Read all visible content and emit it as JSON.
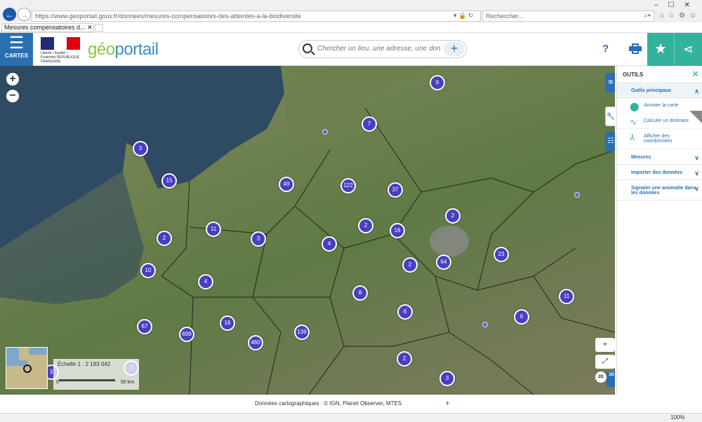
{
  "browser": {
    "url": "https://www.geoportail.gouv.fr/donnees/mesures-compensatoires-des-atteintes-a-la-biodiversite",
    "tab_title": "Mesures compensatoires d...",
    "search_placeholder": "Rechercher..."
  },
  "header": {
    "menu_label": "CARTES",
    "rf_text": "Liberté • Égalité • Fraternité RÉPUBLIQUE FRANÇAISE",
    "logo_part1": "géo",
    "logo_part2": "portail",
    "search_placeholder": "Chercher un lieu, une adresse, une donnée...",
    "search_add": "+",
    "help_label": "?",
    "fav_icon": "★",
    "share_icon": "⋖"
  },
  "map": {
    "clusters": [
      {
        "label": "6"
      },
      {
        "label": "7"
      },
      {
        "label": "3"
      },
      {
        "label": "15"
      },
      {
        "label": "49"
      },
      {
        "label": "122"
      },
      {
        "label": "37"
      },
      {
        "label": "2"
      },
      {
        "label": "11"
      },
      {
        "label": "3"
      },
      {
        "label": "2"
      },
      {
        "label": "2"
      },
      {
        "label": "16"
      },
      {
        "label": "4"
      },
      {
        "label": "2"
      },
      {
        "label": "64"
      },
      {
        "label": "23"
      },
      {
        "label": "10"
      },
      {
        "label": "4"
      },
      {
        "label": "8"
      },
      {
        "label": "11"
      },
      {
        "label": "6"
      },
      {
        "label": "6"
      },
      {
        "label": "67"
      },
      {
        "label": "699"
      },
      {
        "label": "16"
      },
      {
        "label": "136"
      },
      {
        "label": "460"
      },
      {
        "label": "2"
      },
      {
        "label": "2"
      },
      {
        "label": "3"
      },
      {
        "label": "3"
      }
    ],
    "zoom_in": "+",
    "zoom_out": "−",
    "scale_label": "Échelle 1 : 2 183 042",
    "scale_zero": "0",
    "scale_distance": "50 km",
    "geoloc_icon": "⌖",
    "fullscreen_icon": "⤢",
    "view_2d": "2D",
    "view_3d": "3D"
  },
  "tools": {
    "title": "OUTILS",
    "close": "✕",
    "main_section": "Outils principaux",
    "items": [
      {
        "label": "Annoter la carte"
      },
      {
        "label": "Calculer un itinéraire"
      },
      {
        "label": "Afficher des coordonnées"
      }
    ],
    "sections": [
      {
        "label": "Mesures"
      },
      {
        "label": "Importer des données"
      },
      {
        "label": "Signaler une anomalie dans les données"
      }
    ]
  },
  "footer": {
    "credits": "Données cartographiques : © IGN, Planet Observer, MTES",
    "add": "+",
    "zoom_level": "100%"
  }
}
